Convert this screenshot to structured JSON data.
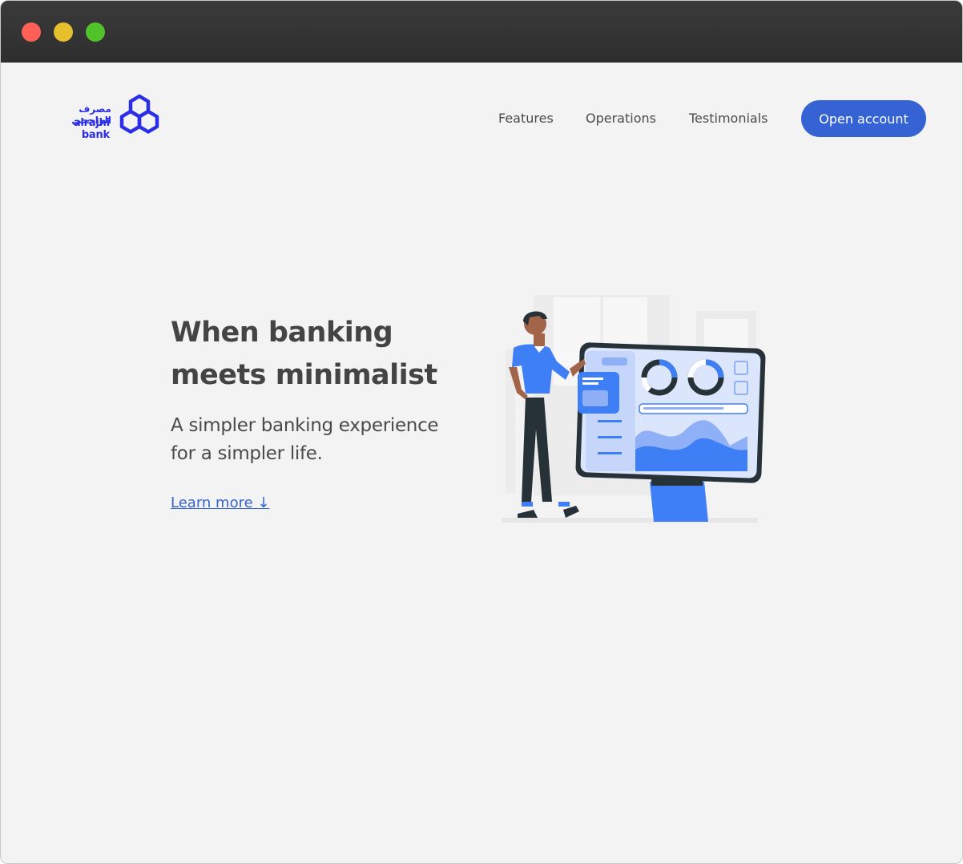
{
  "brand": {
    "name_ar": "مصرف الراجحي",
    "name_en": "alrajhi bank",
    "color": "#2b2ee6"
  },
  "nav": {
    "links": [
      "Features",
      "Operations",
      "Testimonials"
    ],
    "cta_label": "Open account",
    "cta_color": "#3563d4"
  },
  "hero": {
    "title_line1": "When banking",
    "title_line2": "meets minimalist",
    "subtitle_line1": "A simpler banking experience",
    "subtitle_line2": "for a simpler life.",
    "link_label": "Learn more ↓"
  },
  "illustration": {
    "icon": "person-with-dashboard-illustration",
    "accent": "#3f7ff5"
  }
}
